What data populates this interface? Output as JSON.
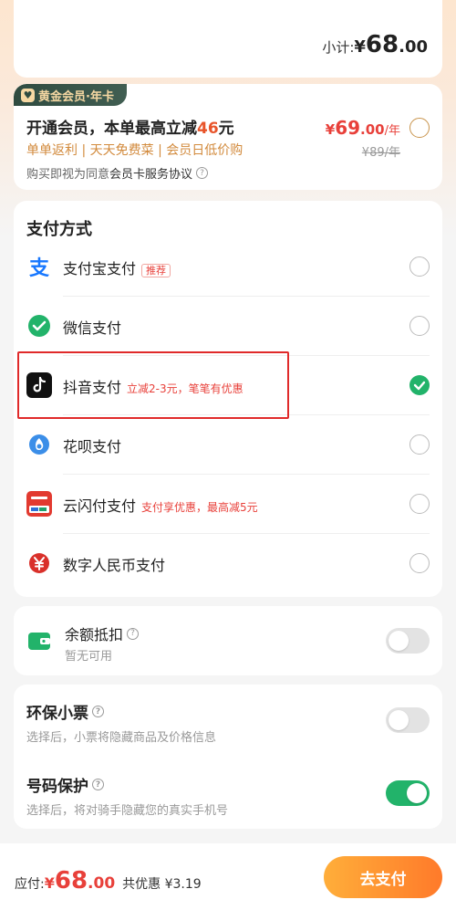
{
  "subtotal": {
    "label": "小计:",
    "currency": "¥",
    "integer": "68",
    "decimal": ".00"
  },
  "membership": {
    "tag": "黄金会员·年卡",
    "title_prefix": "开通会员，本单最高立减",
    "title_amount": "46",
    "title_suffix": "元",
    "benefits": "单单返利 | 天天免费菜 | 会员日低价购",
    "agree_prefix": "购买即视为同意",
    "agree_link": "会员卡服务协议",
    "price_currency": "¥",
    "price_integer": "69",
    "price_decimal": ".00",
    "price_unit": "/年",
    "original_price": "¥89/年"
  },
  "payment": {
    "title": "支付方式",
    "methods": [
      {
        "label": "支付宝支付",
        "badge": "推荐",
        "promo": "",
        "icon": "alipay-icon",
        "selected": false
      },
      {
        "label": "微信支付",
        "badge": "",
        "promo": "",
        "icon": "wechat-pay-icon",
        "selected": false
      },
      {
        "label": "抖音支付",
        "badge": "",
        "promo": "立减2-3元，笔笔有优惠",
        "icon": "douyin-pay-icon",
        "selected": true
      },
      {
        "label": "花呗支付",
        "badge": "",
        "promo": "",
        "icon": "huabei-icon",
        "selected": false
      },
      {
        "label": "云闪付支付",
        "badge": "",
        "promo": "支付享优惠，最高减5元",
        "icon": "unionpay-quickpass-icon",
        "selected": false
      },
      {
        "label": "数字人民币支付",
        "badge": "",
        "promo": "",
        "icon": "digital-rmb-icon",
        "selected": false
      }
    ]
  },
  "balance": {
    "title": "余额抵扣",
    "desc": "暂无可用",
    "enabled": false
  },
  "options": {
    "eco_receipt": {
      "title": "环保小票",
      "desc": "选择后，小票将隐藏商品及价格信息",
      "enabled": false
    },
    "number_protect": {
      "title": "号码保护",
      "desc": "选择后，将对骑手隐藏您的真实手机号",
      "enabled": true
    }
  },
  "footer": {
    "due_label": "应付:",
    "currency": "¥",
    "integer": "68",
    "decimal": ".00",
    "discount": "共优惠 ¥3.19",
    "pay_button": "去支付"
  },
  "colors": {
    "accent_red": "#e8403a",
    "accent_green": "#22b36a",
    "accent_orange": "#ff7a2a",
    "gold": "#d28a3c"
  }
}
